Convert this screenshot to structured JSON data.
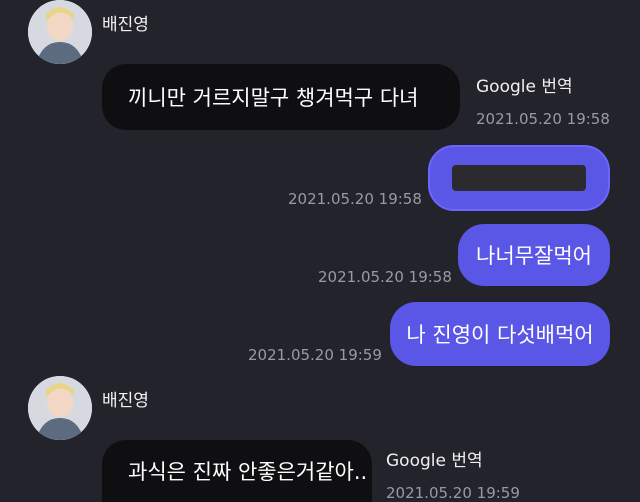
{
  "messages": [
    {
      "sender": "배진영",
      "text": "끼니만 거르지말구 챙겨먹구 다녀",
      "translate_label": "Google 번역",
      "time": "2021.05.20 19:58"
    },
    {
      "text": "",
      "time": "2021.05.20 19:58",
      "redacted": true
    },
    {
      "text": "나너무잘먹어",
      "time": "2021.05.20 19:58"
    },
    {
      "text": "나 진영이 다섯배먹어",
      "time": "2021.05.20 19:59"
    },
    {
      "sender": "배진영",
      "text": "과식은 진짜 안좋은거같아..",
      "translate_label": "Google 번역",
      "time": "2021.05.20 19:59"
    }
  ],
  "colors": {
    "background": "#23232b",
    "incoming_bubble": "#0f0f12",
    "outgoing_bubble": "#5a56e6",
    "timestamp": "#9a9aa6"
  }
}
